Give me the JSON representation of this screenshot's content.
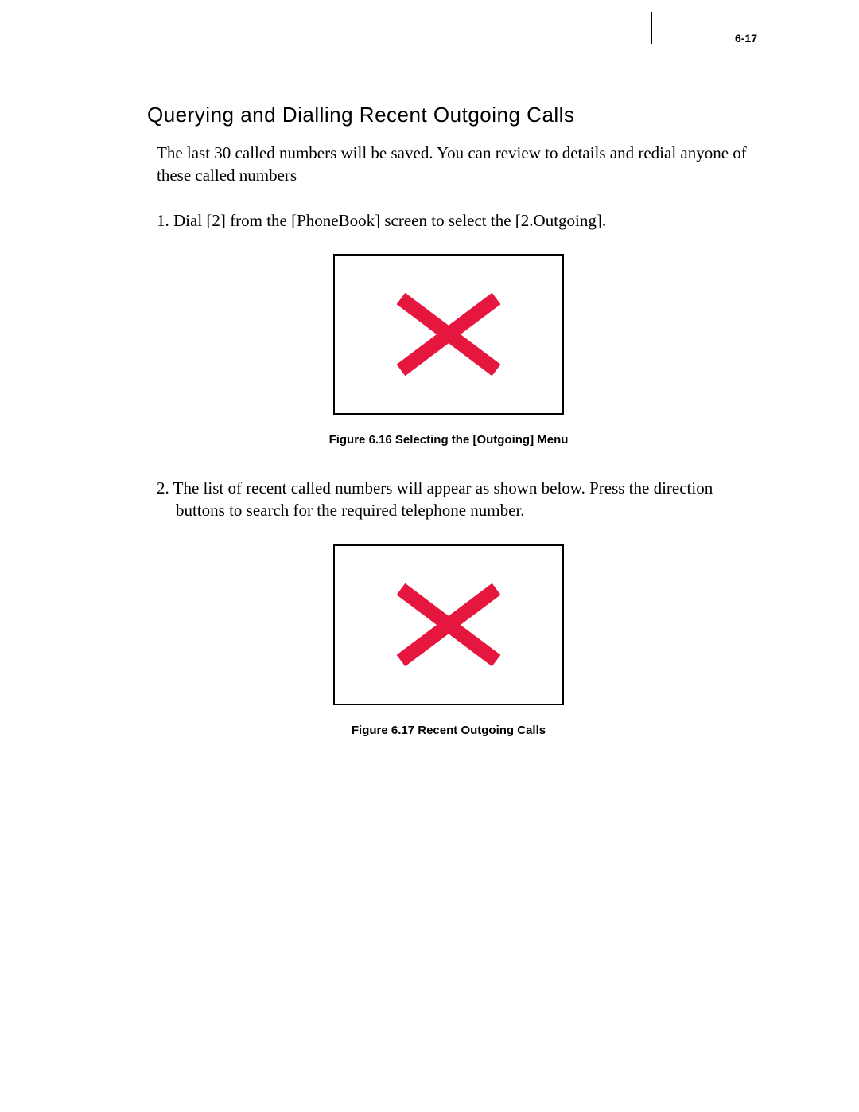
{
  "header": {
    "page_number": "6-17"
  },
  "section": {
    "title": "Querying and Dialling Recent Outgoing Calls",
    "intro": "The last 30 called numbers will be saved. You can review to details and redial anyone of these called numbers",
    "step1": "1. Dial [2] from the [PhoneBook] screen to select the [2.Outgoing].",
    "step2": "2.  The list of recent called numbers will appear as shown below. Press the direction buttons to search for the required telephone number."
  },
  "figures": {
    "fig1_caption": "Figure 6.16  Selecting the [Outgoing] Menu",
    "fig2_caption": "Figure 6.17  Recent Outgoing Calls"
  }
}
